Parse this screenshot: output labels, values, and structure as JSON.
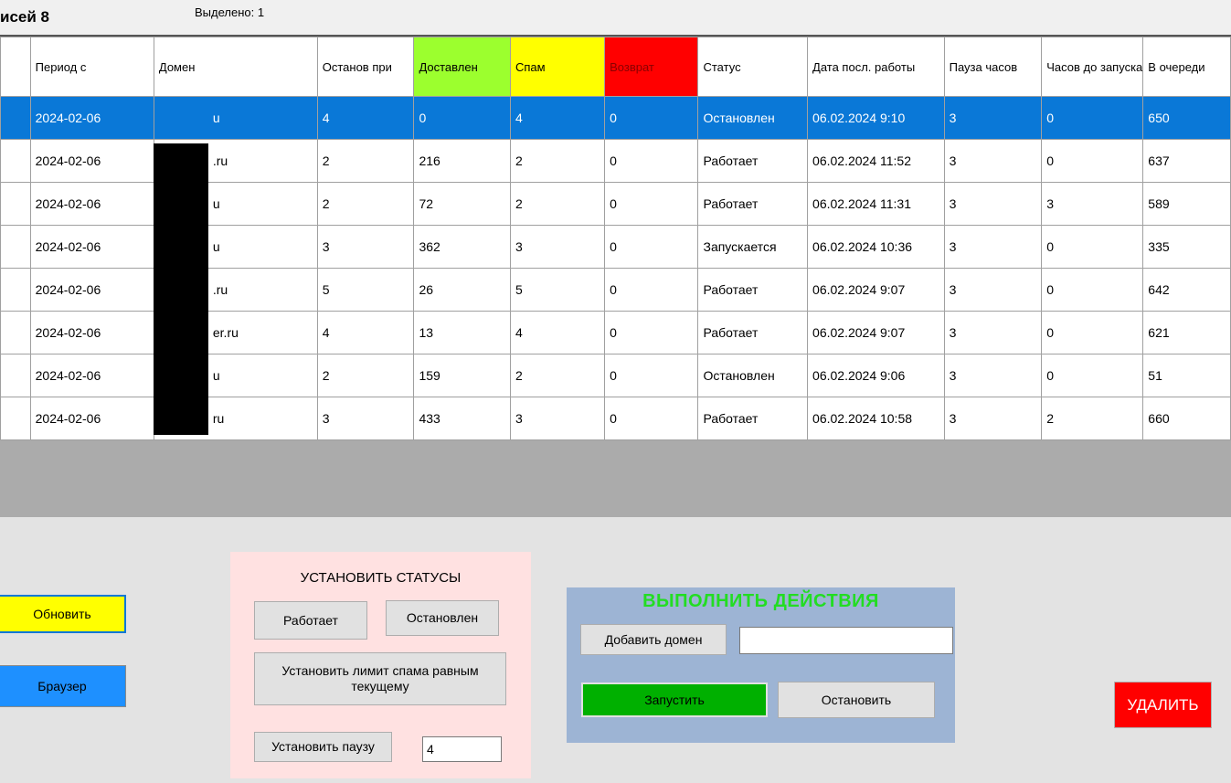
{
  "header": {
    "records_label": "исей 8",
    "selected_label": "Выделено: 1"
  },
  "grid": {
    "columns": [
      {
        "key": "period",
        "label": "Период с"
      },
      {
        "key": "domain",
        "label": "Домен"
      },
      {
        "key": "stop_at",
        "label": "Останов при"
      },
      {
        "key": "delivered",
        "label": "Доставлен"
      },
      {
        "key": "spam",
        "label": "Спам"
      },
      {
        "key": "returned",
        "label": "Возврат"
      },
      {
        "key": "status",
        "label": "Статус"
      },
      {
        "key": "last_run",
        "label": "Дата посл. работы"
      },
      {
        "key": "pause_hours",
        "label": "Пауза часов"
      },
      {
        "key": "hours_to_start",
        "label": "Часов до запуска"
      },
      {
        "key": "queue",
        "label": "В очереди"
      }
    ],
    "header_colors": {
      "delivered": "#9cff2e",
      "spam": "#ffff00",
      "returned": "#ff0000"
    },
    "selected_color": "#0a78d7",
    "rows": [
      {
        "period": "2024-02-06",
        "domain": "u",
        "stop_at": "4",
        "delivered": "0",
        "spam": "4",
        "returned": "0",
        "status": "Остановлен",
        "last_run": "06.02.2024 9:10",
        "pause_hours": "3",
        "hours_to_start": "0",
        "queue": "650",
        "selected": true
      },
      {
        "period": "2024-02-06",
        "domain": ".ru",
        "stop_at": "2",
        "delivered": "216",
        "spam": "2",
        "returned": "0",
        "status": "Работает",
        "last_run": "06.02.2024 11:52",
        "pause_hours": "3",
        "hours_to_start": "0",
        "queue": "637"
      },
      {
        "period": "2024-02-06",
        "domain": "u",
        "stop_at": "2",
        "delivered": "72",
        "spam": "2",
        "returned": "0",
        "status": "Работает",
        "last_run": "06.02.2024 11:31",
        "pause_hours": "3",
        "hours_to_start": "3",
        "queue": "589"
      },
      {
        "period": "2024-02-06",
        "domain": "u",
        "stop_at": "3",
        "delivered": "362",
        "spam": "3",
        "returned": "0",
        "status": "Запускается",
        "last_run": "06.02.2024 10:36",
        "pause_hours": "3",
        "hours_to_start": "0",
        "queue": "335"
      },
      {
        "period": "2024-02-06",
        "domain": ".ru",
        "stop_at": "5",
        "delivered": "26",
        "spam": "5",
        "returned": "0",
        "status": "Работает",
        "last_run": "06.02.2024 9:07",
        "pause_hours": "3",
        "hours_to_start": "0",
        "queue": "642"
      },
      {
        "period": "2024-02-06",
        "domain": "er.ru",
        "stop_at": "4",
        "delivered": "13",
        "spam": "4",
        "returned": "0",
        "status": "Работает",
        "last_run": "06.02.2024 9:07",
        "pause_hours": "3",
        "hours_to_start": "0",
        "queue": "621"
      },
      {
        "period": "2024-02-06",
        "domain": "u",
        "stop_at": "2",
        "delivered": "159",
        "spam": "2",
        "returned": "0",
        "status": "Остановлен",
        "last_run": "06.02.2024 9:06",
        "pause_hours": "3",
        "hours_to_start": "0",
        "queue": "51"
      },
      {
        "period": "2024-02-06",
        "domain": "ru",
        "stop_at": "3",
        "delivered": "433",
        "spam": "3",
        "returned": "0",
        "status": "Работает",
        "last_run": "06.02.2024 10:58",
        "pause_hours": "3",
        "hours_to_start": "2",
        "queue": "660"
      }
    ],
    "scroll_arrow": "›"
  },
  "buttons": {
    "refresh": "Обновить",
    "browser": "Браузер",
    "delete": "УДАЛИТЬ"
  },
  "status_panel": {
    "title": "УСТАНОВИТЬ СТАТУСЫ",
    "working": "Работает",
    "stopped": "Остановлен",
    "set_spam_limit": "Установить лимит спама равным текущему",
    "set_pause": "Установить паузу",
    "pause_value": "4"
  },
  "actions_panel": {
    "title": "ВЫПОЛНИТЬ ДЕЙСТВИЯ",
    "add_domain": "Добавить домен",
    "domain_value": "",
    "start": "Запустить",
    "stop": "Остановить"
  },
  "colors": {
    "refresh_bg": "#ffff00",
    "browser_bg": "#1e90ff",
    "start_bg": "#00b000",
    "delete_bg": "#ff0000",
    "actions_title": "#22dd22",
    "status_panel_bg": "#ffe1e1",
    "actions_panel_bg": "#9db4d4"
  }
}
